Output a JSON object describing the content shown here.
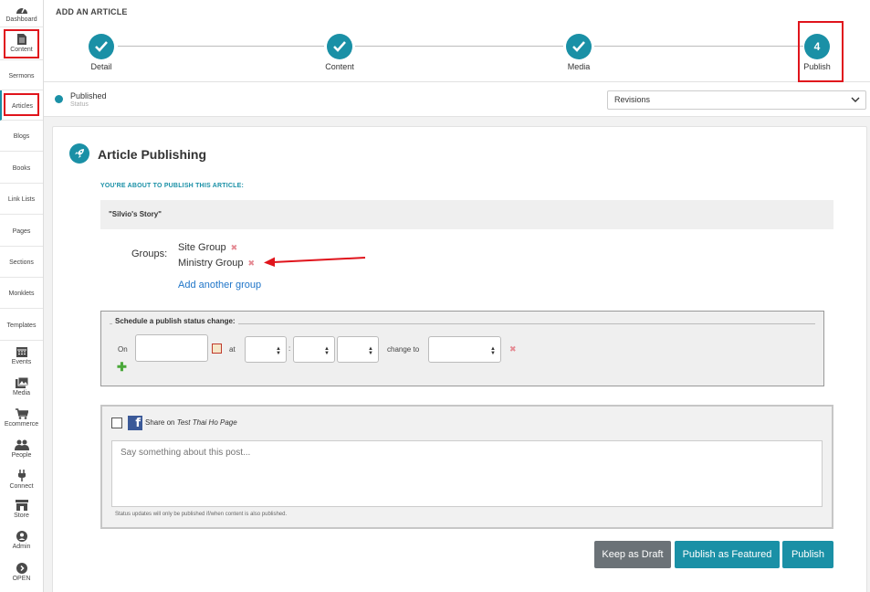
{
  "sidebar": {
    "items": [
      {
        "label": "Dashboard",
        "icon": "dashboard-icon"
      },
      {
        "label": "Content",
        "icon": "document-icon"
      },
      {
        "label": "Sermons"
      },
      {
        "label": "Articles"
      },
      {
        "label": "Blogs"
      },
      {
        "label": "Books"
      },
      {
        "label": "Link Lists"
      },
      {
        "label": "Pages"
      },
      {
        "label": "Sections"
      },
      {
        "label": "Monklets"
      },
      {
        "label": "Templates"
      },
      {
        "label": "Events",
        "icon": "calendar-icon"
      },
      {
        "label": "Media",
        "icon": "image-icon"
      },
      {
        "label": "Ecommerce",
        "icon": "cart-icon"
      },
      {
        "label": "People",
        "icon": "people-icon"
      },
      {
        "label": "Connect",
        "icon": "plug-icon"
      },
      {
        "label": "Store",
        "icon": "store-icon"
      },
      {
        "label": "Admin",
        "icon": "user-icon"
      },
      {
        "label": "OPEN",
        "icon": "chevron-right-icon"
      }
    ]
  },
  "header": {
    "title": "ADD AN ARTICLE",
    "steps": [
      {
        "label": "Detail",
        "state": "complete"
      },
      {
        "label": "Content",
        "state": "complete"
      },
      {
        "label": "Media",
        "state": "complete"
      },
      {
        "label": "Publish",
        "state": "current",
        "number": "4"
      }
    ]
  },
  "status": {
    "value": "Published",
    "label": "Status",
    "revisions": "Revisions"
  },
  "publishing": {
    "title": "Article Publishing",
    "about": "YOU'RE ABOUT TO PUBLISH THIS ARTICLE:",
    "article_title": "\"Silvio's Story\"",
    "groups_label": "Groups:",
    "groups": [
      "Site Group",
      "Ministry Group"
    ],
    "add_group": "Add another group"
  },
  "schedule": {
    "legend": "Schedule a publish status change:",
    "on_label": "On",
    "at_label": "at",
    "colon": ":",
    "change_to_label": "change to"
  },
  "share": {
    "prefix": "Share on",
    "page": "Test Thai Ho Page",
    "placeholder": "Say something about this post...",
    "note": "Status updates will only be published if/when content is also published."
  },
  "buttons": {
    "draft": "Keep as Draft",
    "featured": "Publish as Featured",
    "publish": "Publish"
  },
  "colors": {
    "accent": "#1a90a6",
    "draft_button": "#6b7277",
    "highlight": "#e0141c",
    "arrow": "#e0141c"
  }
}
